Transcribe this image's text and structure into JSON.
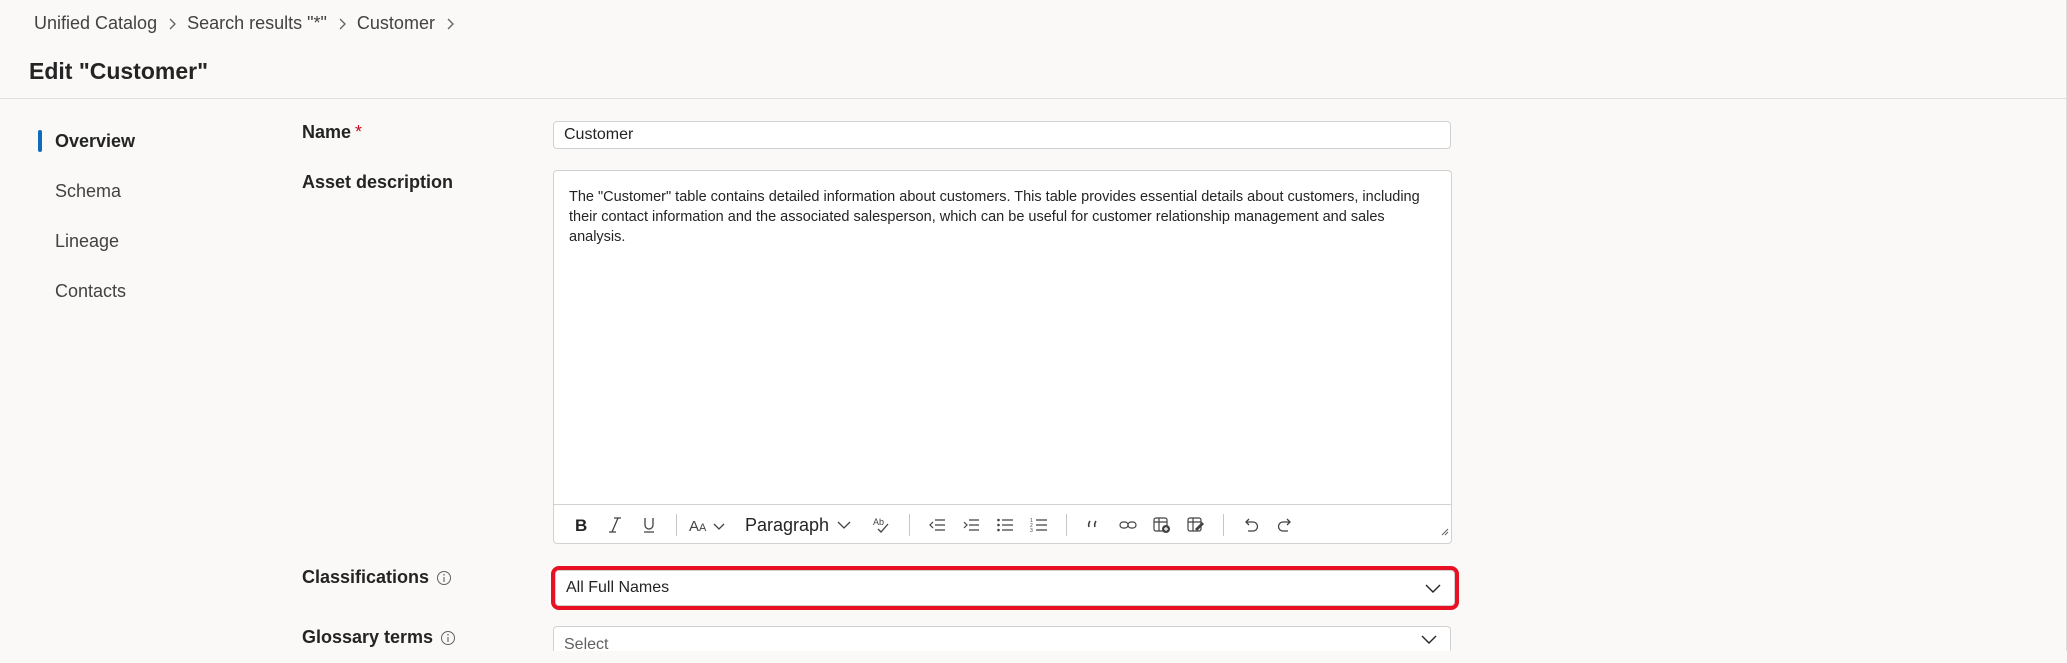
{
  "breadcrumb": {
    "items": [
      "Unified Catalog",
      "Search results \"*\"",
      "Customer"
    ]
  },
  "page": {
    "title": "Edit \"Customer\""
  },
  "sidenav": {
    "items": [
      {
        "label": "Overview",
        "active": true
      },
      {
        "label": "Schema",
        "active": false
      },
      {
        "label": "Lineage",
        "active": false
      },
      {
        "label": "Contacts",
        "active": false
      }
    ]
  },
  "form": {
    "name": {
      "label": "Name",
      "required_mark": "*",
      "value": "Customer"
    },
    "description": {
      "label": "Asset description",
      "value": "The \"Customer\" table contains detailed information about customers. This table provides essential details about customers, including their contact information and the associated salesperson, which can be useful for customer relationship management and sales analysis.",
      "toolbar": {
        "paragraph_label": "Paragraph",
        "buttons": [
          "bold-icon",
          "italic-icon",
          "underline-icon",
          "font-size-icon",
          "paragraph-style",
          "spellcheck-icon",
          "outdent-icon",
          "indent-icon",
          "bullet-list-icon",
          "numbered-list-icon",
          "quote-icon",
          "link-icon",
          "insert-table-icon",
          "table-edit-icon",
          "undo-icon",
          "redo-icon"
        ]
      }
    },
    "classifications": {
      "label": "Classifications",
      "value": "All Full Names"
    },
    "glossary_terms": {
      "label": "Glossary terms",
      "placeholder": "Select"
    }
  },
  "colors": {
    "accent": "#0f6cbd",
    "required": "#c50f1f",
    "focus_outline": "#e81123"
  }
}
